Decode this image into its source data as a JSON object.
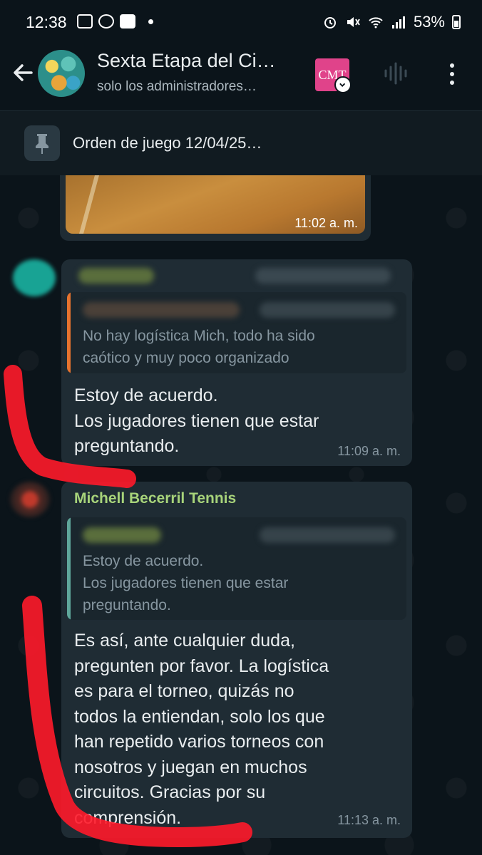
{
  "status_bar": {
    "time": "12:38",
    "battery": "53%"
  },
  "header": {
    "title": "Sexta Etapa del Ci…",
    "subtitle": "solo los administradores…",
    "badge": "CMT"
  },
  "pinned": {
    "text": "Orden de juego 12/04/25…"
  },
  "messages": [
    {
      "type": "photo",
      "time": "11:02 a. m."
    },
    {
      "quote": "No hay logística Mich, todo ha sido caótico y muy poco organizado",
      "quote_lines": [
        "No hay logística Mich, todo ha sido",
        "caótico y muy poco organizado"
      ],
      "text_lines": [
        "Estoy de acuerdo.",
        "Los jugadores tienen que estar",
        "preguntando."
      ],
      "time": "11:09 a. m."
    },
    {
      "sender": "Michell Becerril Tennis",
      "quote_lines": [
        "Estoy de acuerdo.",
        "Los jugadores tienen que estar",
        "preguntando."
      ],
      "text_lines": [
        "Es así, ante cualquier duda,",
        "pregunten por favor. La logística",
        "es para el torneo, quizás no",
        "todos la entiendan, solo los que",
        "han repetido varios torneos con",
        "nosotros y juegan en muchos",
        "circuitos. Gracias por su",
        "comprensión."
      ],
      "time": "11:13 a. m."
    }
  ],
  "colors": {
    "background": "#0b141a",
    "bubble": "#1f2c34",
    "sender_name": "#a7d37a",
    "quote_bar_orange": "#e6732e",
    "quote_bar_teal": "#5fa79b",
    "annotation_red": "#ff1a2a"
  }
}
